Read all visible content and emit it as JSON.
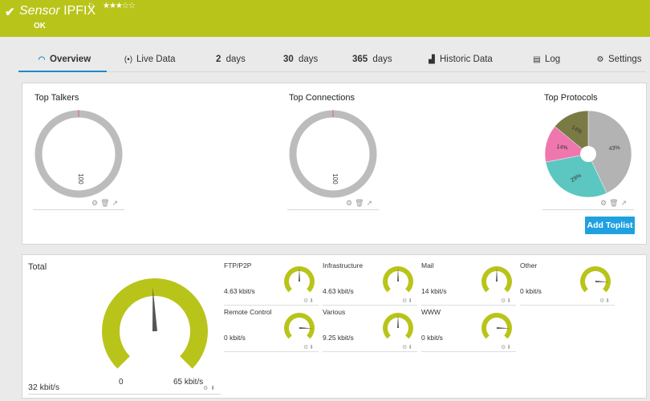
{
  "header": {
    "title_italic": "Sensor",
    "title_name": "IPFIX",
    "status": "OK",
    "stars_text": "★★★☆☆"
  },
  "tabs": [
    {
      "label": "Overview",
      "icon": "overview-icon",
      "active": true
    },
    {
      "label": "Live Data",
      "icon": "live-data-icon"
    },
    {
      "num": "2",
      "label": "days"
    },
    {
      "num": "30",
      "label": "days"
    },
    {
      "num": "365",
      "label": "days"
    },
    {
      "label": "Historic Data",
      "icon": "historic-data-icon"
    },
    {
      "label": "Log",
      "icon": "log-icon"
    },
    {
      "label": "Settings",
      "icon": "gear-icon"
    }
  ],
  "toplists": {
    "talkers": {
      "title": "Top Talkers",
      "value_label": "100"
    },
    "connections": {
      "title": "Top Connections",
      "value_label": "100"
    },
    "protocols": {
      "title": "Top Protocols"
    },
    "add_button": "Add Toplist"
  },
  "chart_data": {
    "type": "pie",
    "title": "Top Protocols",
    "slices": [
      {
        "label": "43%",
        "value": 43,
        "color": "#b3b3b3"
      },
      {
        "label": "29%",
        "value": 29,
        "color": "#5cc6c0"
      },
      {
        "label": "14%",
        "value": 14,
        "color": "#ee78ae"
      },
      {
        "label": "14%",
        "value": 14,
        "color": "#7a7a45"
      }
    ]
  },
  "total": {
    "label": "Total",
    "value": "32 kbit/s",
    "min": "0",
    "max": "65 kbit/s",
    "needle_fraction": 0.49
  },
  "channels": [
    {
      "name": "FTP/P2P",
      "value": "4.63 kbit/s",
      "fraction": 0.5
    },
    {
      "name": "Infrastructure",
      "value": "4.63 kbit/s",
      "fraction": 0.5
    },
    {
      "name": "Mail",
      "value": "14 kbit/s",
      "fraction": 0.5
    },
    {
      "name": "Other",
      "value": "0 kbit/s",
      "fraction": 0.0
    },
    {
      "name": "Remote Control",
      "value": "0 kbit/s",
      "fraction": 0.0
    },
    {
      "name": "Various",
      "value": "9.25 kbit/s",
      "fraction": 0.5
    },
    {
      "name": "WWW",
      "value": "0 kbit/s",
      "fraction": 0.0
    }
  ],
  "colors": {
    "header": "#b9c41a",
    "gauge": "#b9c41a",
    "accent_blue": "#1a8bc8",
    "ring_gray": "#bcbcbc"
  }
}
